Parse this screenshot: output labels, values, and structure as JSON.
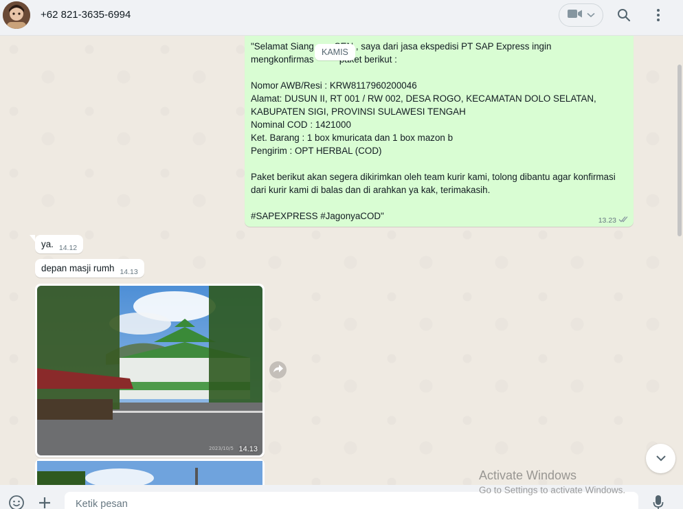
{
  "header": {
    "contact_name": "+62 821-3635-6994",
    "icons": [
      "video-call-icon",
      "chevron-down-icon",
      "search-icon",
      "menu-icon"
    ]
  },
  "chat": {
    "day_chip": "KAMIS",
    "outgoing": {
      "text": "\"Selamat Siang        SEN , saya dari jasa ekspedisi PT SAP Express ingin\nmengkonfirmas          paket berikut :\n\nNomor AWB/Resi : KRW8117960200046\nAlamat: DUSUN II, RT 001 / RW 002, DESA ROGO, KECAMATAN DOLO SELATAN,\nKABUPATEN SIGI, PROVINSI SULAWESI TENGAH\nNominal COD : 1421000\nKet. Barang : 1 box kmuricata dan 1 box mazon b\nPengirim : OPT HERBAL (COD)\n\nPaket berikut akan segera dikirimkan oleh team kurir kami, tolong dibantu agar konfirmasi\ndari kurir kami di balas dan di arahkan ya kak, terimakasih.\n\n#SAPEXPRESS #JagonyaCOD\"",
      "time": "13.23"
    },
    "incoming": [
      {
        "text": "ya.",
        "time": "14.12"
      },
      {
        "text": "depan masji rumh",
        "time": "14.13"
      }
    ],
    "image_message": {
      "time": "14.13"
    }
  },
  "watermark": {
    "line1": "Activate Windows",
    "line2": "Go to Settings to activate Windows."
  },
  "composer": {
    "placeholder": "Ketik pesan"
  }
}
